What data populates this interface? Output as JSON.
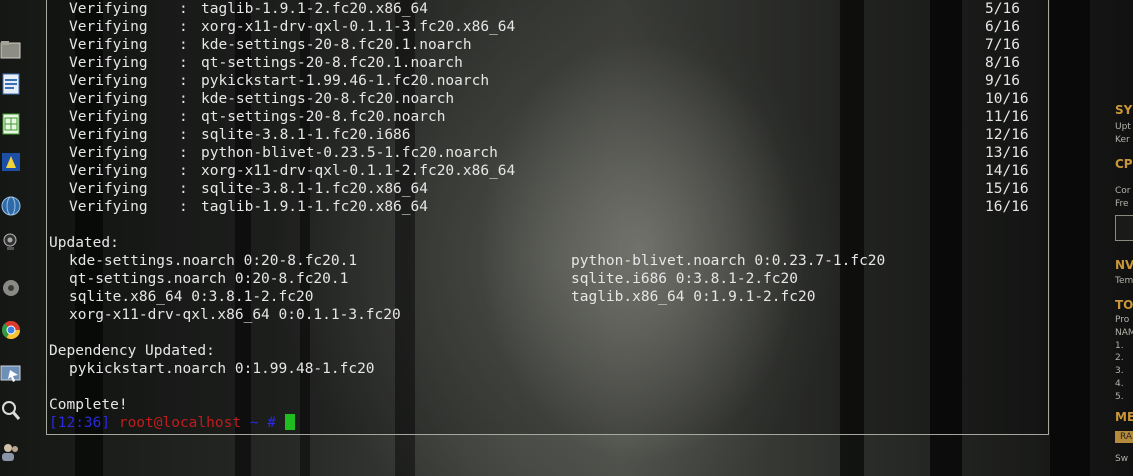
{
  "terminal": {
    "verifying_lines": [
      {
        "label": "Verifying",
        "package": "taglib-1.9.1-2.fc20.x86_64",
        "count": "5/16"
      },
      {
        "label": "Verifying",
        "package": "xorg-x11-drv-qxl-0.1.1-3.fc20.x86_64",
        "count": "6/16"
      },
      {
        "label": "Verifying",
        "package": "kde-settings-20-8.fc20.1.noarch",
        "count": "7/16"
      },
      {
        "label": "Verifying",
        "package": "qt-settings-20-8.fc20.1.noarch",
        "count": "8/16"
      },
      {
        "label": "Verifying",
        "package": "pykickstart-1.99.46-1.fc20.noarch",
        "count": "9/16"
      },
      {
        "label": "Verifying",
        "package": "kde-settings-20-8.fc20.noarch",
        "count": "10/16"
      },
      {
        "label": "Verifying",
        "package": "qt-settings-20-8.fc20.noarch",
        "count": "11/16"
      },
      {
        "label": "Verifying",
        "package": "sqlite-3.8.1-1.fc20.i686",
        "count": "12/16"
      },
      {
        "label": "Verifying",
        "package": "python-blivet-0.23.5-1.fc20.noarch",
        "count": "13/16"
      },
      {
        "label": "Verifying",
        "package": "xorg-x11-drv-qxl-0.1.1-2.fc20.x86_64",
        "count": "14/16"
      },
      {
        "label": "Verifying",
        "package": "sqlite-3.8.1-1.fc20.x86_64",
        "count": "15/16"
      },
      {
        "label": "Verifying",
        "package": "taglib-1.9.1-1.fc20.x86_64",
        "count": "16/16"
      }
    ],
    "separator": ":",
    "updated_heading": "Updated:",
    "updated_rows": [
      {
        "left": "kde-settings.noarch 0:20-8.fc20.1",
        "right": "python-blivet.noarch 0:0.23.7-1.fc20"
      },
      {
        "left": "qt-settings.noarch 0:20-8.fc20.1",
        "right": "sqlite.i686 0:3.8.1-2.fc20"
      },
      {
        "left": "sqlite.x86_64 0:3.8.1-2.fc20",
        "right": "taglib.x86_64 0:1.9.1-2.fc20"
      },
      {
        "left": "xorg-x11-drv-qxl.x86_64 0:0.1.1-3.fc20",
        "right": ""
      }
    ],
    "dependency_heading": "Dependency Updated:",
    "dependency_rows": [
      "pykickstart.noarch 0:1.99.48-1.fc20"
    ],
    "complete_text": "Complete!",
    "prompt": {
      "time": "[12:36]",
      "user_host": "root@localhost",
      "tilde": "~",
      "symbol": "#"
    },
    "colors": {
      "prompt_time": "#2a2ad8",
      "prompt_user": "#c01c1c",
      "cursor": "#1fbd1f",
      "text": "#e6e6e6"
    }
  },
  "dock": {
    "icons": [
      "folder-icon",
      "document-icon",
      "spreadsheet-icon",
      "presentation-icon",
      "web-globe-icon",
      "webcam-icon",
      "settings-gear-icon",
      "chrome-icon",
      "monitor-icon",
      "magnifier-icon",
      "users-icon"
    ]
  },
  "conky": {
    "items": [
      {
        "kind": "hd",
        "text": "SY"
      },
      {
        "kind": "tx",
        "text": "Upt"
      },
      {
        "kind": "tx",
        "text": "Ker"
      },
      {
        "kind": "hd",
        "text": "CP"
      },
      {
        "kind": "tx",
        "text": "Cor"
      },
      {
        "kind": "tx",
        "text": "Fre"
      },
      {
        "kind": "hd",
        "text": "NV"
      },
      {
        "kind": "tx",
        "text": "Tem"
      },
      {
        "kind": "hd",
        "text": "TO"
      },
      {
        "kind": "tx",
        "text": "Pro"
      },
      {
        "kind": "tx",
        "text": "NAM"
      },
      {
        "kind": "tx",
        "text": "1."
      },
      {
        "kind": "tx",
        "text": "2."
      },
      {
        "kind": "tx",
        "text": "3."
      },
      {
        "kind": "tx",
        "text": "4."
      },
      {
        "kind": "tx",
        "text": "5."
      },
      {
        "kind": "hd",
        "text": "ME"
      },
      {
        "kind": "bar",
        "text": "RA"
      },
      {
        "kind": "tx",
        "text": "Sw"
      }
    ],
    "colors": {
      "heading": "#c9973a",
      "text": "#b3b3aa",
      "bar": "#b58a3c"
    }
  }
}
